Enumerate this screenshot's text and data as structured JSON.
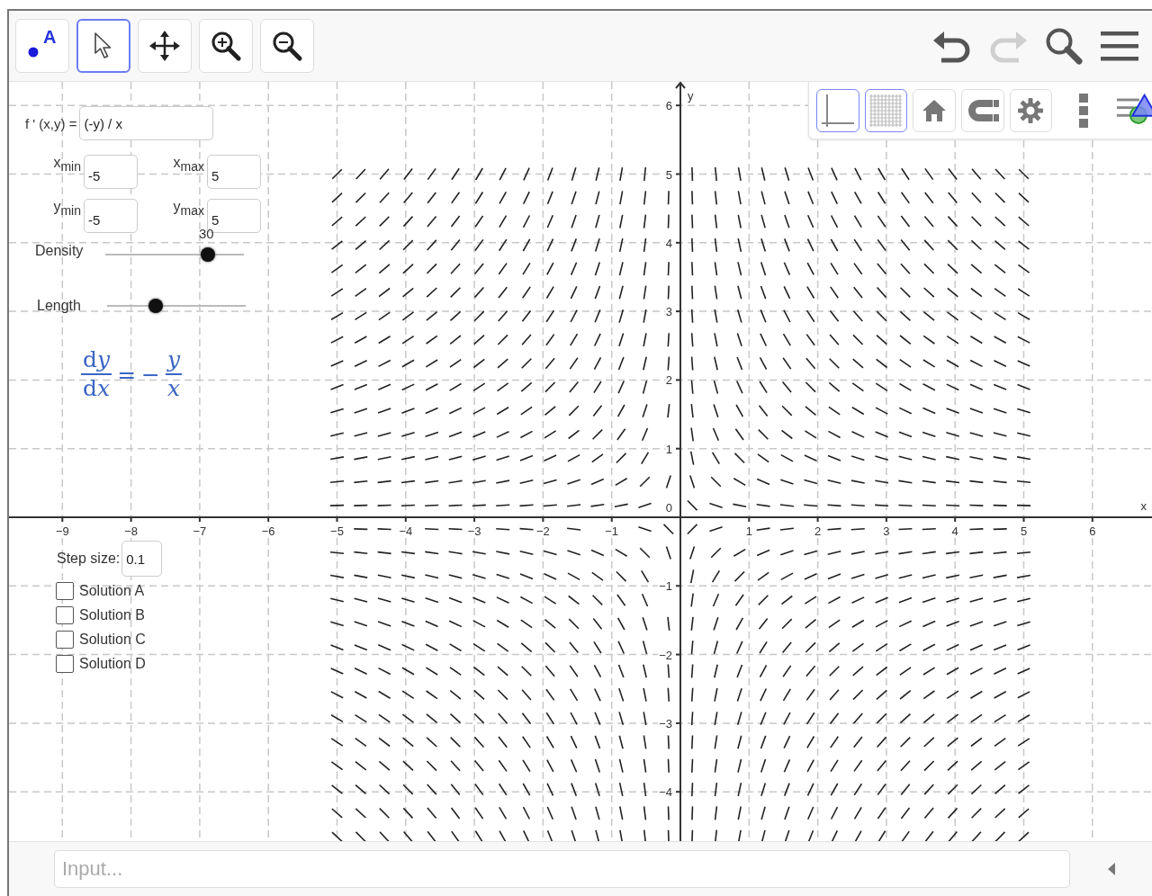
{
  "toolbar": {
    "tools": [
      {
        "kind": "point",
        "label": "A",
        "selected": false
      },
      {
        "kind": "select",
        "selected": true
      },
      {
        "kind": "move-view",
        "selected": false
      },
      {
        "kind": "zoom-in",
        "selected": false
      },
      {
        "kind": "zoom-out",
        "selected": false
      }
    ],
    "actions": [
      {
        "kind": "undo",
        "disabled": false
      },
      {
        "kind": "redo",
        "disabled": true
      },
      {
        "kind": "search",
        "disabled": false
      },
      {
        "kind": "menu",
        "disabled": false
      }
    ]
  },
  "style_bar": {
    "buttons": [
      {
        "kind": "axes",
        "selected": true
      },
      {
        "kind": "grid",
        "selected": true
      },
      {
        "kind": "home",
        "selected": false
      },
      {
        "kind": "magnet",
        "selected": false
      },
      {
        "kind": "settings",
        "selected": false
      }
    ],
    "extras": [
      {
        "kind": "more"
      },
      {
        "kind": "view"
      }
    ]
  },
  "graph": {
    "x_axis_label": "x",
    "y_axis_label": "y",
    "origin_label": "0",
    "x_tick_labels": [
      "−9",
      "−8",
      "−7",
      "−6",
      "−5",
      "−4",
      "−3",
      "−2",
      "−1",
      "1",
      "2",
      "3",
      "4",
      "5",
      "6"
    ],
    "y_tick_labels": [
      "6",
      "5",
      "4",
      "3",
      "2",
      "1",
      "−1",
      "−2",
      "−3",
      "−4"
    ]
  },
  "panel": {
    "function": {
      "label": "f ' (x,y) =",
      "value": "(-y) / x"
    },
    "bounds": [
      {
        "label": "x$_{min}$",
        "value": "-5"
      },
      {
        "label": "x$_{max}$",
        "value": "5"
      },
      {
        "label": "y$_{min}$",
        "value": "-5"
      },
      {
        "label": "y$_{max}$",
        "value": "5"
      }
    ],
    "sliders": [
      {
        "label": "Density",
        "reading": "30",
        "level": 0.74
      },
      {
        "label": "Length",
        "level": 0.35
      }
    ],
    "formula": {
      "lhs_numerator": "dy",
      "lhs_denominator": "dx",
      "relation": "=",
      "sign": "−",
      "rhs_numerator": "y",
      "rhs_denominator": "x"
    },
    "step_size": {
      "label": "Step size:",
      "value": "0.1"
    },
    "solutions": [
      {
        "label": "Solution A",
        "checked": false
      },
      {
        "label": "Solution B",
        "checked": false
      },
      {
        "label": "Solution C",
        "checked": false
      },
      {
        "label": "Solution D",
        "checked": false
      }
    ]
  },
  "input_bar": {
    "placeholder": "Input..."
  }
}
